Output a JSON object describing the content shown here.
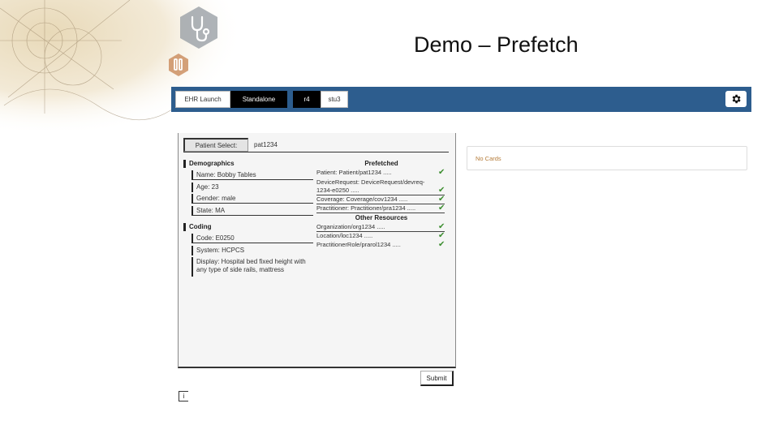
{
  "slide": {
    "title": "Demo – Prefetch"
  },
  "toolbar": {
    "tabs": [
      {
        "label": "EHR Launch"
      },
      {
        "label": "Standalone"
      },
      {
        "label": "r4"
      },
      {
        "label": "stu3"
      }
    ],
    "settings_icon": "gear-icon"
  },
  "patient_select": {
    "button_label": "Patient Select:",
    "value": "pat1234"
  },
  "demographics": {
    "heading": "Demographics",
    "name": "Name: Bobby Tables",
    "age": "Age: 23",
    "gender": "Gender: male",
    "state": "State: MA"
  },
  "coding": {
    "heading": "Coding",
    "code": "Code: E0250",
    "system": "System: HCPCS",
    "display_line1": "Display: Hospital bed fixed height with",
    "display_line2": "any type of side rails, mattress"
  },
  "prefetched": {
    "heading": "Prefetched",
    "items": [
      "Patient: Patient/pat1234 .....",
      "DeviceRequest: DeviceRequest/devreq-",
      "1234-e0250 .....",
      "Coverage: Coverage/cov1234 .....",
      "Practitioner: Practitioner/pra1234 ....."
    ],
    "other_heading": "Other Resources",
    "other_items": [
      "Organization/org1234 .....",
      "Location/loc1234 .....",
      "PractitionerRole/prarol1234 ....."
    ],
    "check_glyph": "✔",
    "check_color": "#3c8d2f"
  },
  "cards": {
    "empty_text": "No Cards"
  },
  "submit": {
    "label": "Submit"
  },
  "mini_button": {
    "label": "i"
  },
  "colors": {
    "toolbar": "#2d5d8e",
    "active_tab": "#000000"
  }
}
